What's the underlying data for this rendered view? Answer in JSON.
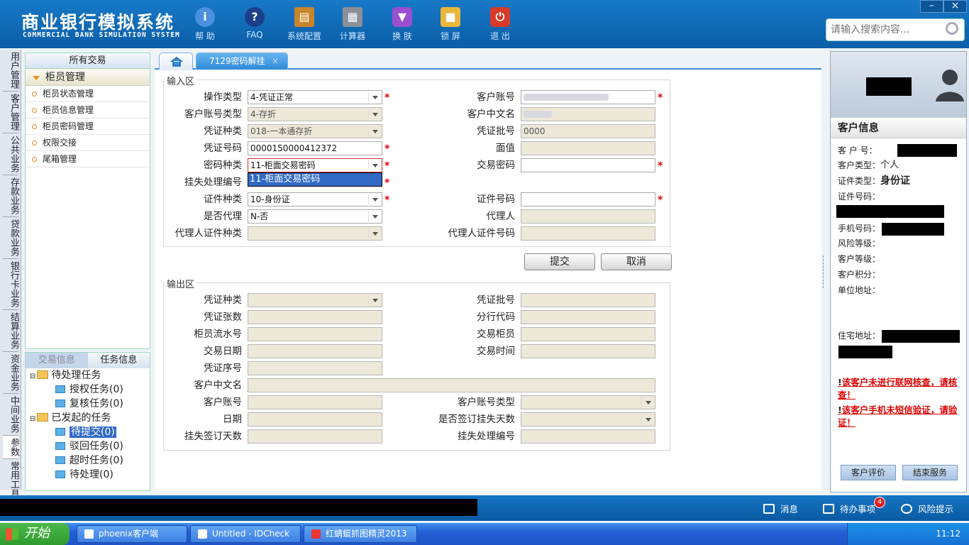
{
  "header": {
    "title_cn": "商业银行模拟系统",
    "title_en": "COMMERCIAL BANK SIMULATION SYSTEM",
    "toolbar": [
      {
        "label": "帮 助",
        "icon": "info-icon"
      },
      {
        "label": "FAQ",
        "icon": "question-icon"
      },
      {
        "label": "系统配置",
        "icon": "toolbox-icon"
      },
      {
        "label": "计算器",
        "icon": "calculator-icon"
      },
      {
        "label": "换 肤",
        "icon": "shirt-icon"
      },
      {
        "label": "锁 屏",
        "icon": "lock-icon"
      },
      {
        "label": "退 出",
        "icon": "power-icon"
      }
    ],
    "search_placeholder": "请输入搜索内容..."
  },
  "left_vertical_tabs": [
    "用户管理",
    "客户管理",
    "公共业务",
    "存款业务",
    "贷款业务",
    "银行卡业务",
    "结算业务",
    "资金业务",
    "中间业务",
    "参数",
    "常用工具"
  ],
  "nav": {
    "header": "所有交易",
    "group": "柜员管理",
    "items": [
      "柜员状态管理",
      "柜员信息管理",
      "柜员密码管理",
      "权限交接",
      "尾箱管理"
    ]
  },
  "task_panel": {
    "tabs": [
      "交易信息",
      "任务信息"
    ],
    "pending_folder": "待处理任务",
    "pending_items": [
      "授权任务(0)",
      "复核任务(0)"
    ],
    "initiated_folder": "已发起的任务",
    "initiated_items": [
      "待提交(0)",
      "驳回任务(0)",
      "超时任务(0)",
      "待处理(0)"
    ]
  },
  "tabs": {
    "active": "7129密码解挂"
  },
  "input_area": {
    "legend": "输入区",
    "labels": {
      "op_type": "操作类型",
      "acct_type": "客户账号类型",
      "voucher_kind": "凭证种类",
      "voucher_no": "凭证号码",
      "pwd_kind": "密码种类",
      "loss_no": "挂失处理编号",
      "id_kind": "证件种类",
      "is_agent": "是否代理",
      "agent_id_kind": "代理人证件种类",
      "acct_no": "客户账号",
      "cn_name": "客户中文名",
      "batch_no": "凭证批号",
      "face_value": "面值",
      "trade_pwd": "交易密码",
      "id_no": "证件号码",
      "agent": "代理人",
      "agent_id_no": "代理人证件号码"
    },
    "values": {
      "op_type": "4-凭证正常",
      "acct_type": "4-存折",
      "voucher_kind": "018-一本通存折",
      "voucher_no": "0000150000412372",
      "pwd_kind": "11-柜面交易密码",
      "pwd_dropdown_option": "11-柜面交易密码",
      "id_kind": "10-身份证",
      "is_agent": "N-否",
      "batch_no": "0000"
    }
  },
  "buttons": {
    "submit": "提交",
    "cancel": "取消"
  },
  "output_area": {
    "legend": "输出区",
    "labels": {
      "voucher_kind": "凭证种类",
      "voucher_count": "凭证张数",
      "teller_serial": "柜员流水号",
      "trade_date": "交易日期",
      "voucher_seq": "凭证序号",
      "cn_name": "客户中文名",
      "acct_no": "客户账号",
      "date": "日期",
      "loss_days": "挂失签订天数",
      "batch_no": "凭证批号",
      "branch_code": "分行代码",
      "trade_teller": "交易柜员",
      "trade_time": "交易时间",
      "acct_type": "客户账号类型",
      "sign_loss_days": "是否签订挂失天数",
      "loss_no": "挂失处理编号"
    }
  },
  "customer": {
    "header": "客户信息",
    "labels": {
      "cust_no": "客 户 号：",
      "cust_type": "客户类型：",
      "id_type": "证件类型：",
      "id_no": "证件号码：",
      "phone": "手机号码：",
      "risk": "风险等级：",
      "level": "客户等级：",
      "points": "客户积分：",
      "work_addr": "单位地址：",
      "home_addr": "住宅地址："
    },
    "cust_type_value": "个人",
    "id_type_value": "身份证",
    "warnings": [
      "该客户未进行联网核查，请核查！",
      "该客户手机未短信验证，请验证！"
    ],
    "warn_mark": "!",
    "btn_eval": "客户评价",
    "btn_end": "结束服务"
  },
  "statusbar": {
    "msg": "消息",
    "todo": "待办事项",
    "todo_count": "4",
    "risk": "风险提示"
  },
  "taskbar": {
    "start": "开始",
    "items": [
      "phoenix客户端",
      "Untitled - IDCheck",
      "红蜻蜓抓图精灵2013"
    ],
    "clock": "11:12"
  },
  "colors": {
    "accent": "#0b5ea8",
    "required": "#dd0000",
    "selection": "#316ac5"
  }
}
